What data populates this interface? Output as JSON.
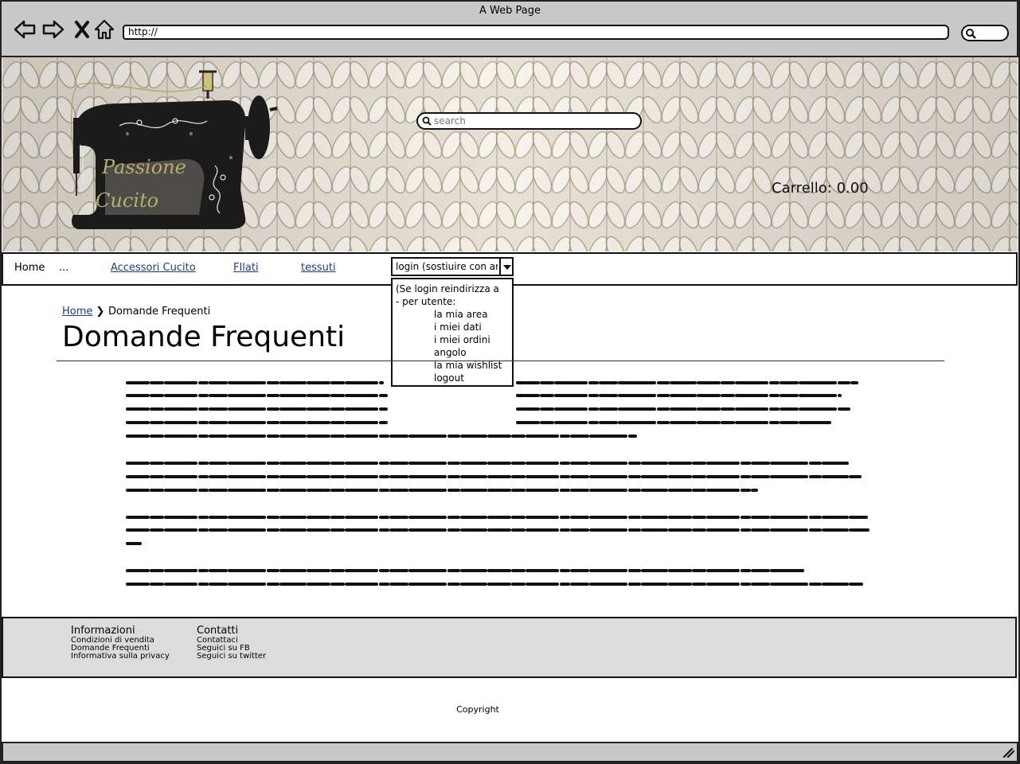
{
  "browser": {
    "title": "A Web Page",
    "url": "http://",
    "icons": [
      "back-arrow-icon",
      "forward-arrow-icon",
      "close-x-icon",
      "home-icon",
      "search-icon"
    ]
  },
  "header": {
    "logo_text": [
      "Passione",
      "Cucito"
    ],
    "search_placeholder": "search",
    "cart_label": "Carrello: 0.00"
  },
  "nav": {
    "items": [
      "Home",
      "...",
      "Accessori Cucito",
      "FIlati",
      "tessuti"
    ],
    "login_select": "login (sostiuire con area",
    "login_dropdown": [
      "(Se login reindirizza a",
      "- per utente:",
      "la mia area",
      "i miei dati",
      "i miei ordini",
      "angolo",
      "la mia wishlist",
      "logout"
    ]
  },
  "breadcrumb": {
    "home": "Home",
    "current": "Domande Frequenti"
  },
  "page_title": "Domande Frequenti",
  "footer": {
    "columns": [
      {
        "title": "Informazioni",
        "links": [
          "Condizioni di vendita",
          "Domande Frequenti",
          "Informativa sulla privacy"
        ]
      },
      {
        "title": "Contatti",
        "links": [
          "Contattaci",
          "Seguici su FB",
          "Seguici su twitter"
        ]
      }
    ],
    "copyright": "Copyright"
  },
  "colors": {
    "chrome": "#c8c8c8",
    "link": "#1d3b8c",
    "footer": "#dcdcdc"
  }
}
